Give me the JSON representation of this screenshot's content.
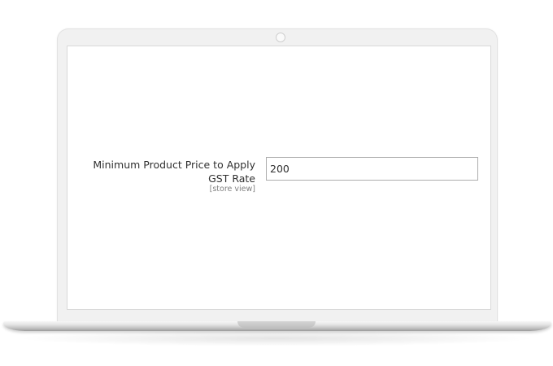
{
  "form": {
    "field": {
      "label": "Minimum Product Price to Apply GST Rate",
      "scope": "[store view]",
      "value": "200"
    }
  }
}
